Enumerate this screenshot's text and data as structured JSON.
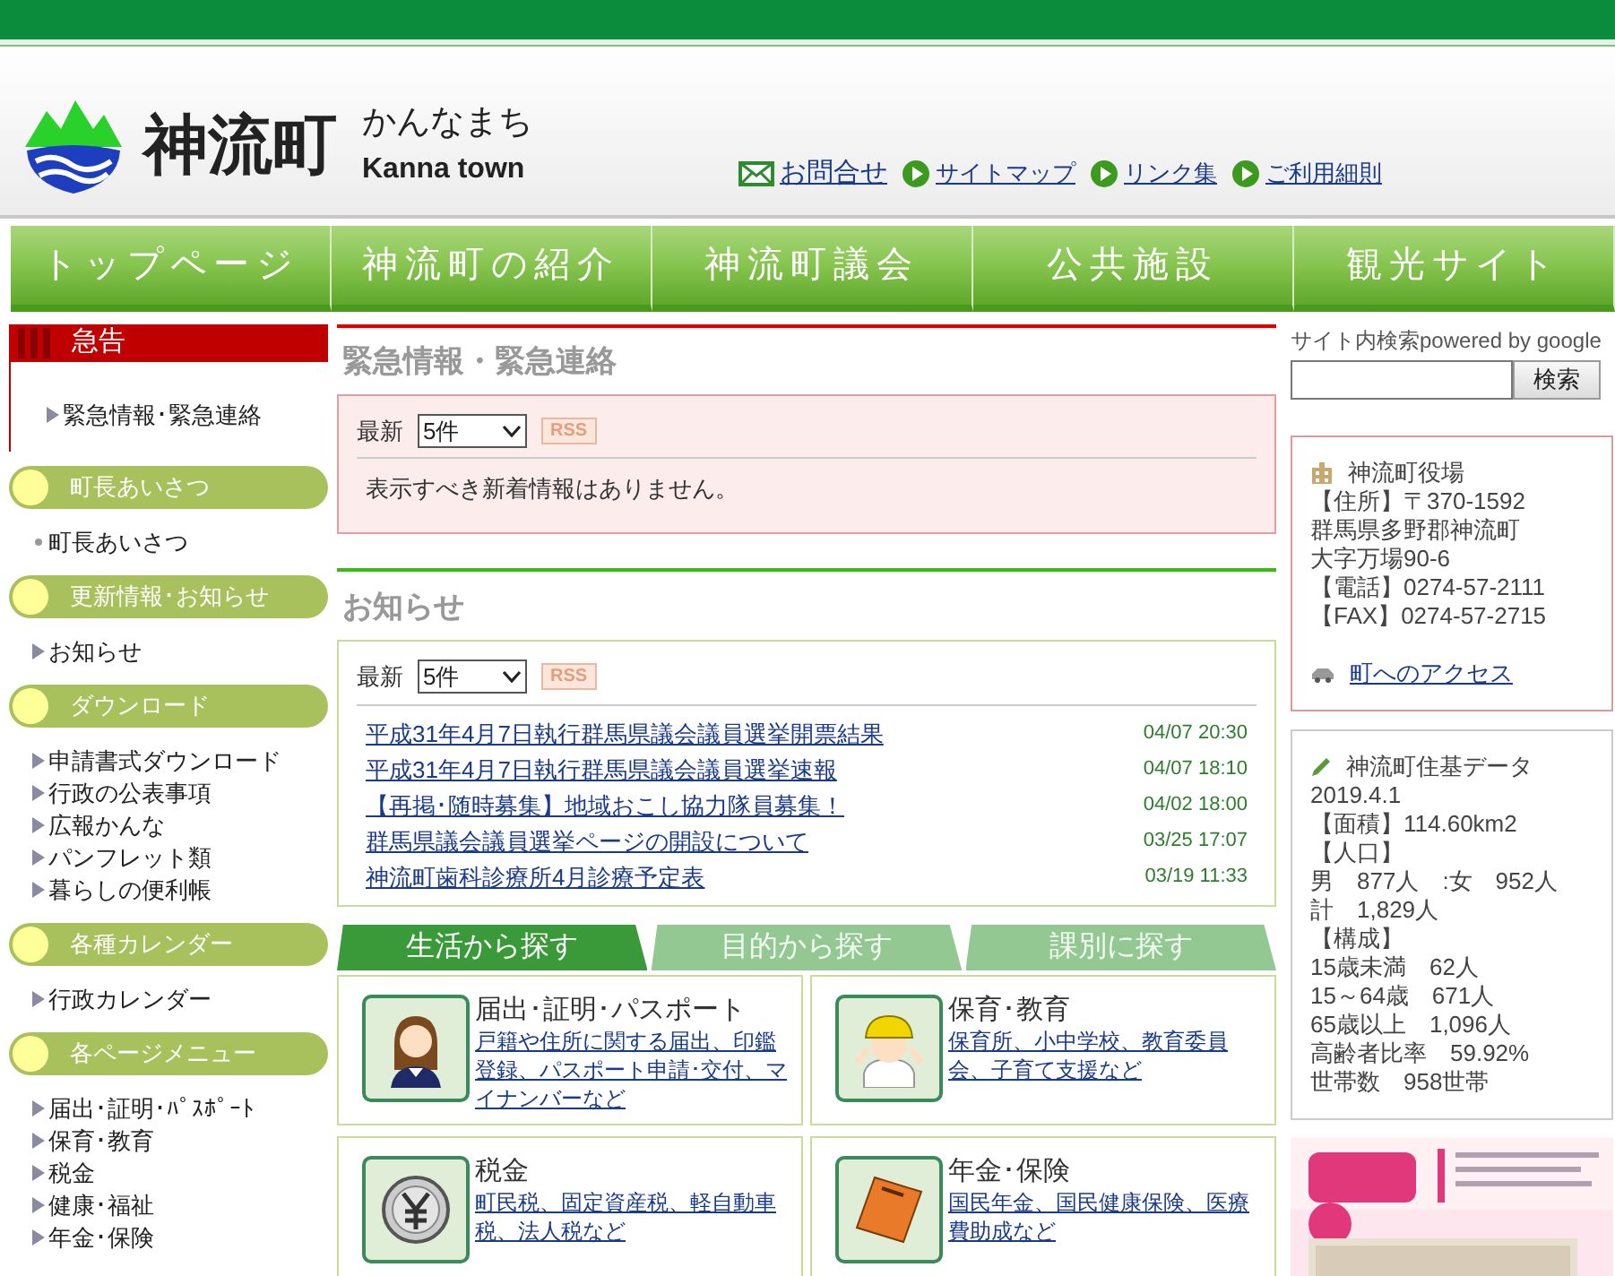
{
  "header": {
    "logo": {
      "name": "神流町",
      "kana": "かんなまち",
      "roman": "Kanna town"
    },
    "links": [
      {
        "label": "お問合せ",
        "kind": "mail"
      },
      {
        "label": "サイトマップ",
        "kind": "arrow"
      },
      {
        "label": "リンク集",
        "kind": "arrow"
      },
      {
        "label": "ご利用細則",
        "kind": "arrow"
      }
    ]
  },
  "nav": [
    "トップページ",
    "神流町の紹介",
    "神流町議会",
    "公共施設",
    "観光サイト"
  ],
  "sidebar": {
    "alert": {
      "title": "急告",
      "items": [
        "緊急情報･緊急連絡"
      ]
    },
    "sections": [
      {
        "title": "町長あいさつ",
        "items": [
          {
            "label": "町長あいさつ",
            "kind": "dot"
          }
        ]
      },
      {
        "title": "更新情報･お知らせ",
        "items": [
          {
            "label": "お知らせ",
            "kind": "arrow"
          }
        ]
      },
      {
        "title": "ダウンロード",
        "items": [
          {
            "label": "申請書式ダウンロード",
            "kind": "arrow"
          },
          {
            "label": "行政の公表事項",
            "kind": "arrow"
          },
          {
            "label": "広報かんな",
            "kind": "arrow"
          },
          {
            "label": "パンフレット類",
            "kind": "arrow"
          },
          {
            "label": "暮らしの便利帳",
            "kind": "arrow"
          }
        ]
      },
      {
        "title": "各種カレンダー",
        "items": [
          {
            "label": "行政カレンダー",
            "kind": "arrow"
          }
        ]
      },
      {
        "title": "各ページメニュー",
        "items": [
          {
            "label": "届出･証明･ﾊﾟｽﾎﾟｰﾄ",
            "kind": "arrow"
          },
          {
            "label": "保育･教育",
            "kind": "arrow"
          },
          {
            "label": "税金",
            "kind": "arrow"
          },
          {
            "label": "健康･福祉",
            "kind": "arrow"
          },
          {
            "label": "年金･保険",
            "kind": "arrow"
          }
        ]
      }
    ]
  },
  "emergency": {
    "title": "緊急情報・緊急連絡",
    "filter_label": "最新",
    "count": "5件",
    "rss": "RSS",
    "message": "表示すべき新着情報はありません。"
  },
  "news": {
    "title": "お知らせ",
    "filter_label": "最新",
    "count": "5件",
    "rss": "RSS",
    "items": [
      {
        "title": "平成31年4月7日執行群馬県議会議員選挙開票結果",
        "time": "04/07 20:30"
      },
      {
        "title": "平成31年4月7日執行群馬県議会議員選挙速報",
        "time": "04/07 18:10"
      },
      {
        "title": "【再掲･随時募集】地域おこし協力隊員募集！",
        "time": "04/02 18:00"
      },
      {
        "title": "群馬県議会議員選挙ページの開設について",
        "time": "03/25 17:07"
      },
      {
        "title": "神流町歯科診療所4月診療予定表",
        "time": "03/19 11:33"
      }
    ]
  },
  "search_tabs": [
    {
      "label": "生活から探す",
      "selected": true
    },
    {
      "label": "目的から探す",
      "selected": false
    },
    {
      "label": "課別に探す",
      "selected": false
    }
  ],
  "categories": [
    {
      "title": "届出･証明･パスポート",
      "description": "戸籍や住所に関する届出、印鑑登録、パスポート申請･交付、マイナンバーなど",
      "kind": "person"
    },
    {
      "title": "保育･教育",
      "description": "保育所、小中学校、教育委員会、子育て支援など",
      "kind": "helmet"
    },
    {
      "title": "税金",
      "description": "町民税、固定資産税、軽自動車税、法人税など",
      "kind": "coin"
    },
    {
      "title": "年金･保険",
      "description": "国民年金、国民健康保険、医療費助成など",
      "kind": "book"
    }
  ],
  "site_search": {
    "label": "サイト内検索powered by google",
    "button": "検索"
  },
  "office": {
    "title": "神流町役場",
    "lines": [
      "【住所】〒370-1592",
      "群馬県多野郡神流町",
      "大字万場90-6",
      "【電話】0274-57-2111",
      "【FAX】0274-57-2715"
    ],
    "access_link": "町へのアクセス"
  },
  "stats": {
    "title": "神流町住基データ",
    "lines": [
      "2019.4.1",
      "【面積】114.60km2",
      "【人口】",
      "男　877人　:女　952人",
      "計　1,829人",
      "【構成】",
      "15歳未満　62人",
      "15～64歳　671人",
      "65歳以上　1,096人",
      "高齢者比率　59.92%",
      "世帯数　958世帯"
    ]
  }
}
